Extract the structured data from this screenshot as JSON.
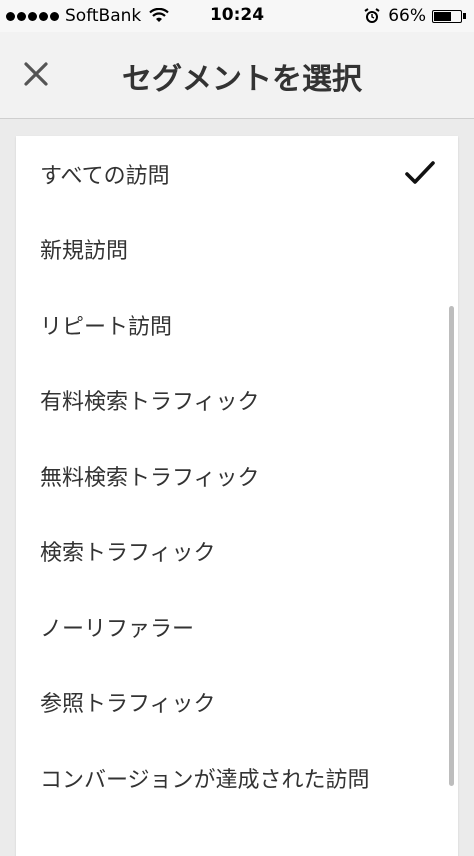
{
  "status_bar": {
    "carrier": "SoftBank",
    "time": "10:24",
    "battery_percent": "66%",
    "battery_level": 0.66
  },
  "header": {
    "title": "セグメントを選択",
    "close_icon": "close-icon"
  },
  "segments": {
    "selected_index": 0,
    "items": [
      {
        "label": "すべての訪問"
      },
      {
        "label": "新規訪問"
      },
      {
        "label": "リピート訪問"
      },
      {
        "label": "有料検索トラフィック"
      },
      {
        "label": "無料検索トラフィック"
      },
      {
        "label": "検索トラフィック"
      },
      {
        "label": "ノーリファラー"
      },
      {
        "label": "参照トラフィック"
      },
      {
        "label": "コンバージョンが達成された訪問"
      }
    ]
  },
  "colors": {
    "header_bg": "#f2f2f2",
    "list_bg": "#ffffff",
    "text": "#333333"
  }
}
